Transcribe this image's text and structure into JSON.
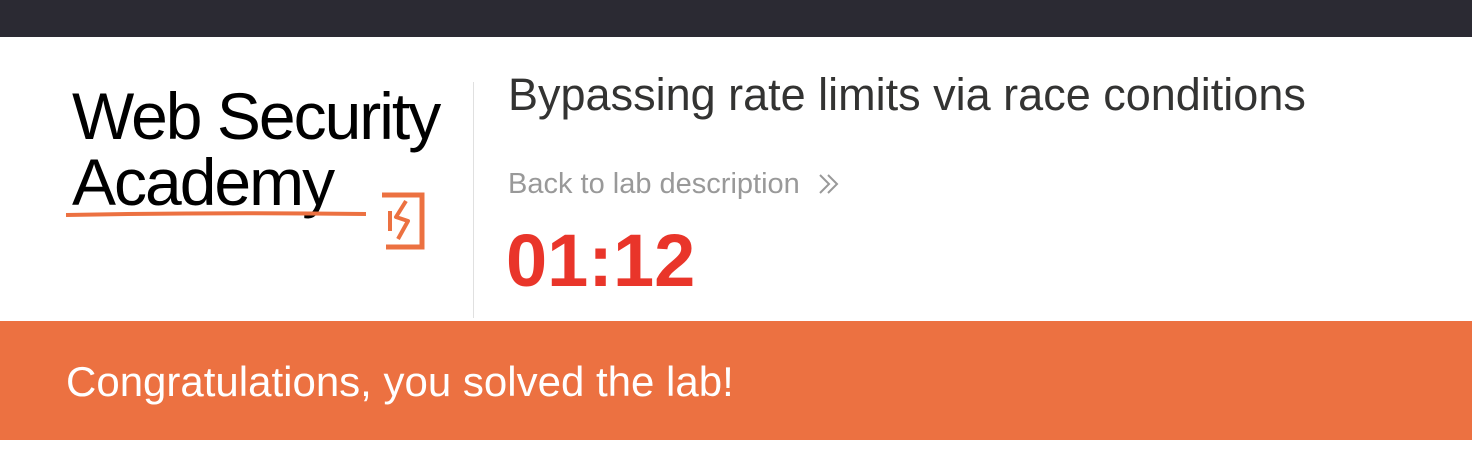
{
  "topbar": {},
  "logo": {
    "line1": "Web Security",
    "line2": "Academy",
    "accent_color": "#ec7141"
  },
  "lab": {
    "title": "Bypassing rate limits via race conditions",
    "back_label": "Back to lab description",
    "back_icon": "double-chevron-right-icon",
    "timer": "01:12",
    "timer_color": "#e9352a"
  },
  "banner": {
    "message": "Congratulations, you solved the lab!",
    "color": "#ec7141"
  }
}
